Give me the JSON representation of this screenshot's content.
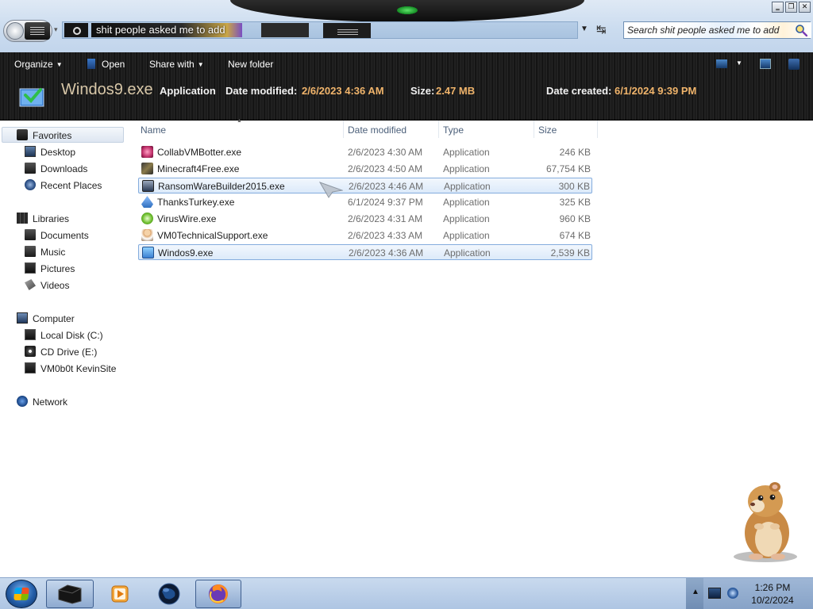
{
  "window": {
    "address_text": "shit people asked me to add",
    "search_placeholder": "Search shit people asked me to add",
    "controls": {
      "minimize": "‗",
      "maximize": "❐",
      "close": "✕"
    }
  },
  "toolbar": {
    "organize": "Organize",
    "open": "Open",
    "share_with": "Share with",
    "new_folder": "New folder"
  },
  "details": {
    "name": "Windos9.exe",
    "type": "Application",
    "modified_label": "Date modified:",
    "modified_value": "2/6/2023 4:36 AM",
    "size_label": "Size:",
    "size_value": "2.47 MB",
    "created_label": "Date created:",
    "created_value": "6/1/2024 9:39 PM"
  },
  "nav": {
    "favorites": "Favorites",
    "desktop": "Desktop",
    "downloads": "Downloads",
    "recent_places": "Recent Places",
    "libraries": "Libraries",
    "documents": "Documents",
    "music": "Music",
    "pictures": "Pictures",
    "videos": "Videos",
    "computer": "Computer",
    "local_disk": "Local Disk (C:)",
    "cd_drive": "CD Drive (E:)",
    "network_share": "VM0b0t KevinSite",
    "network": "Network"
  },
  "columns": {
    "name": "Name",
    "date_modified": "Date modified",
    "type": "Type",
    "size": "Size"
  },
  "files": [
    {
      "name": "CollabVMBotter.exe",
      "date": "2/6/2023 4:30 AM",
      "type": "Application",
      "size": "246 KB",
      "icon": "collab-icon",
      "color": "#c0306a"
    },
    {
      "name": "Minecraft4Free.exe",
      "date": "2/6/2023 4:50 AM",
      "type": "Application",
      "size": "67,754 KB",
      "icon": "minecraft-icon",
      "color": "#5a4a2a"
    },
    {
      "name": "RansomWareBuilder2015.exe",
      "date": "2/6/2023 4:46 AM",
      "type": "Application",
      "size": "300 KB",
      "icon": "ransomware-icon",
      "color": "#2a3a55"
    },
    {
      "name": "ThanksTurkey.exe",
      "date": "6/1/2024 9:37 PM",
      "type": "Application",
      "size": "325 KB",
      "icon": "turkey-icon",
      "color": "#2f6fbf"
    },
    {
      "name": "VirusWire.exe",
      "date": "2/6/2023 4:31 AM",
      "type": "Application",
      "size": "960 KB",
      "icon": "viruswire-icon",
      "color": "#6fbf2f"
    },
    {
      "name": "VM0TechnicalSupport.exe",
      "date": "2/6/2023 4:33 AM",
      "type": "Application",
      "size": "674 KB",
      "icon": "support-icon",
      "color": "#d9a066"
    },
    {
      "name": "Windos9.exe",
      "date": "2/6/2023 4:36 AM",
      "type": "Application",
      "size": "2,539 KB",
      "icon": "windos-icon",
      "color": "#3aa06a"
    }
  ],
  "clock": {
    "time": "1:26 PM",
    "date": "10/2/2024"
  }
}
